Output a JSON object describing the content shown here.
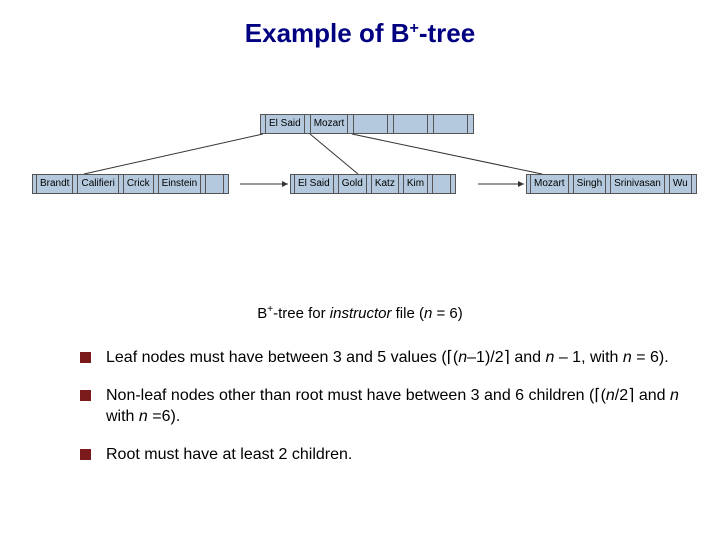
{
  "title": {
    "prefix": "Example of B",
    "sup": "+",
    "suffix": "-tree"
  },
  "tree": {
    "root": {
      "keys": [
        "El Said",
        "Mozart"
      ],
      "ptr_slots": 4,
      "empty_key_slots": 3
    },
    "leaves": [
      {
        "keys": [
          "Brandt",
          "Califieri",
          "Crick",
          "Einstein"
        ]
      },
      {
        "keys": [
          "El Said",
          "Gold",
          "Katz",
          "Kim"
        ]
      },
      {
        "keys": [
          "Mozart",
          "Singh",
          "Srinivasan",
          "Wu"
        ]
      }
    ]
  },
  "caption": {
    "prefix": "B",
    "sup": "+",
    "mid": "-tree for ",
    "file": "instructor",
    "suffix": " file (",
    "nvar": "n",
    "tail": " = 6)"
  },
  "bullets": [
    {
      "lead": "Leaf nodes must have between 3 and 5 values (",
      "ceil_open": "⌈",
      "expr_pre": "(",
      "nvar": "n",
      "expr_post": "–1)/2",
      "ceil_close": "⌉",
      "mid": " and ",
      "nvar2": "n",
      "tail": " – 1, with ",
      "nvar3": "n",
      "end": " = 6)."
    },
    {
      "lead": "Non-leaf nodes other than root must have between 3 and 6 children (",
      "ceil_open": "⌈",
      "expr_pre": "(",
      "nvar": "n",
      "expr_post": "/2",
      "ceil_close": "⌉",
      "mid": " and ",
      "nvar2": "n",
      "tail": " with ",
      "nvar3": "n",
      "end": " =6)."
    },
    {
      "lead": "Root must have at least 2 children."
    }
  ],
  "chart_data": {
    "type": "tree",
    "structure": "B+-tree",
    "n": 6,
    "root": {
      "keys": [
        "El Said",
        "Mozart"
      ]
    },
    "leaves": [
      [
        "Brandt",
        "Califieri",
        "Crick",
        "Einstein"
      ],
      [
        "El Said",
        "Gold",
        "Katz",
        "Kim"
      ],
      [
        "Mozart",
        "Singh",
        "Srinivasan",
        "Wu"
      ]
    ],
    "leaf_links": "sequential"
  }
}
